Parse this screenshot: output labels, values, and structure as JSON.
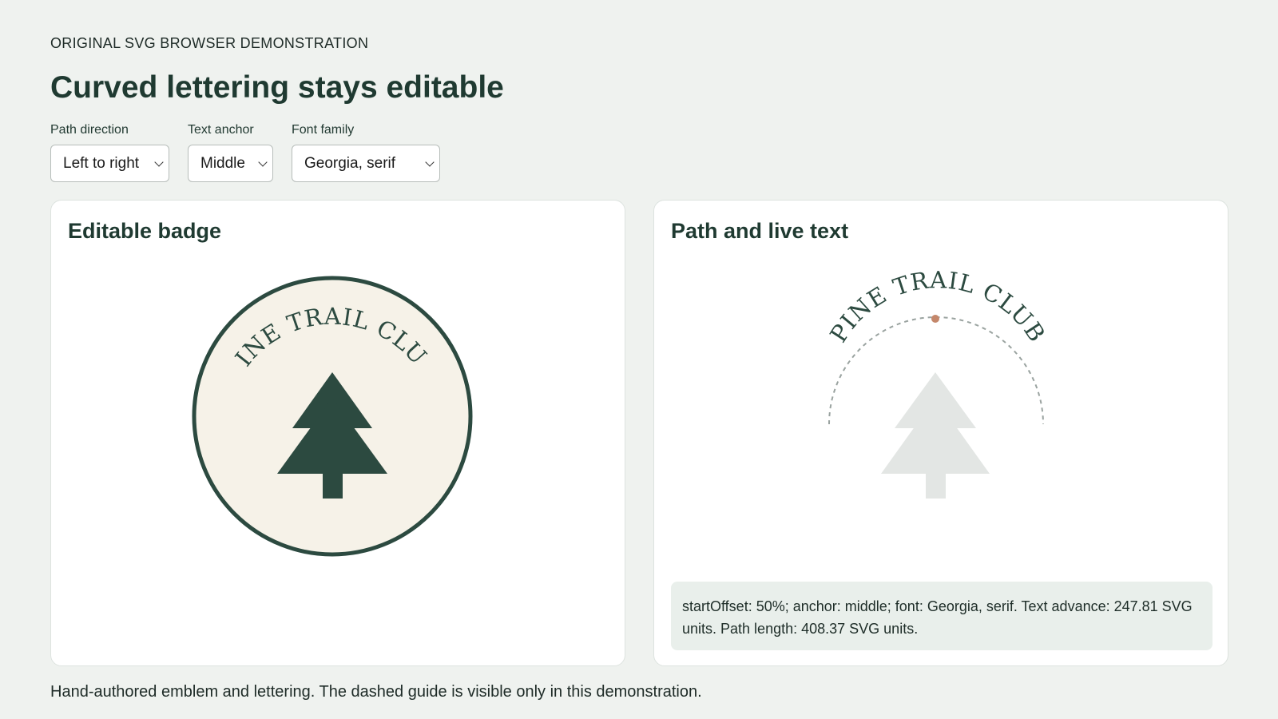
{
  "eyebrow": "ORIGINAL SVG BROWSER DEMONSTRATION",
  "title": "Curved lettering stays editable",
  "controls": {
    "path_direction": {
      "label": "Path direction",
      "value": "Left to right"
    },
    "text_anchor": {
      "label": "Text anchor",
      "value": "Middle"
    },
    "font_family": {
      "label": "Font family",
      "value": "Georgia, serif"
    }
  },
  "badge_card": {
    "title": "Editable badge",
    "badge_text": "PINE TRAIL CLUB"
  },
  "path_card": {
    "title": "Path and live text",
    "live_text": "PINE TRAIL CLUB",
    "info": "startOffset: 50%; anchor: middle; font: Georgia, serif. Text advance: 247.81 SVG units. Path length: 408.37 SVG units."
  },
  "footnote": "Hand-authored emblem and lettering. The dashed guide is visible only in this demonstration.",
  "colors": {
    "page_bg": "#eff2ef",
    "forest_green": "#2c4a40",
    "badge_fill": "#f6f2e8",
    "ghost_tree": "#e3e6e4",
    "guide_dash": "#9aa3a0",
    "anchor_dot": "#c4876b"
  }
}
